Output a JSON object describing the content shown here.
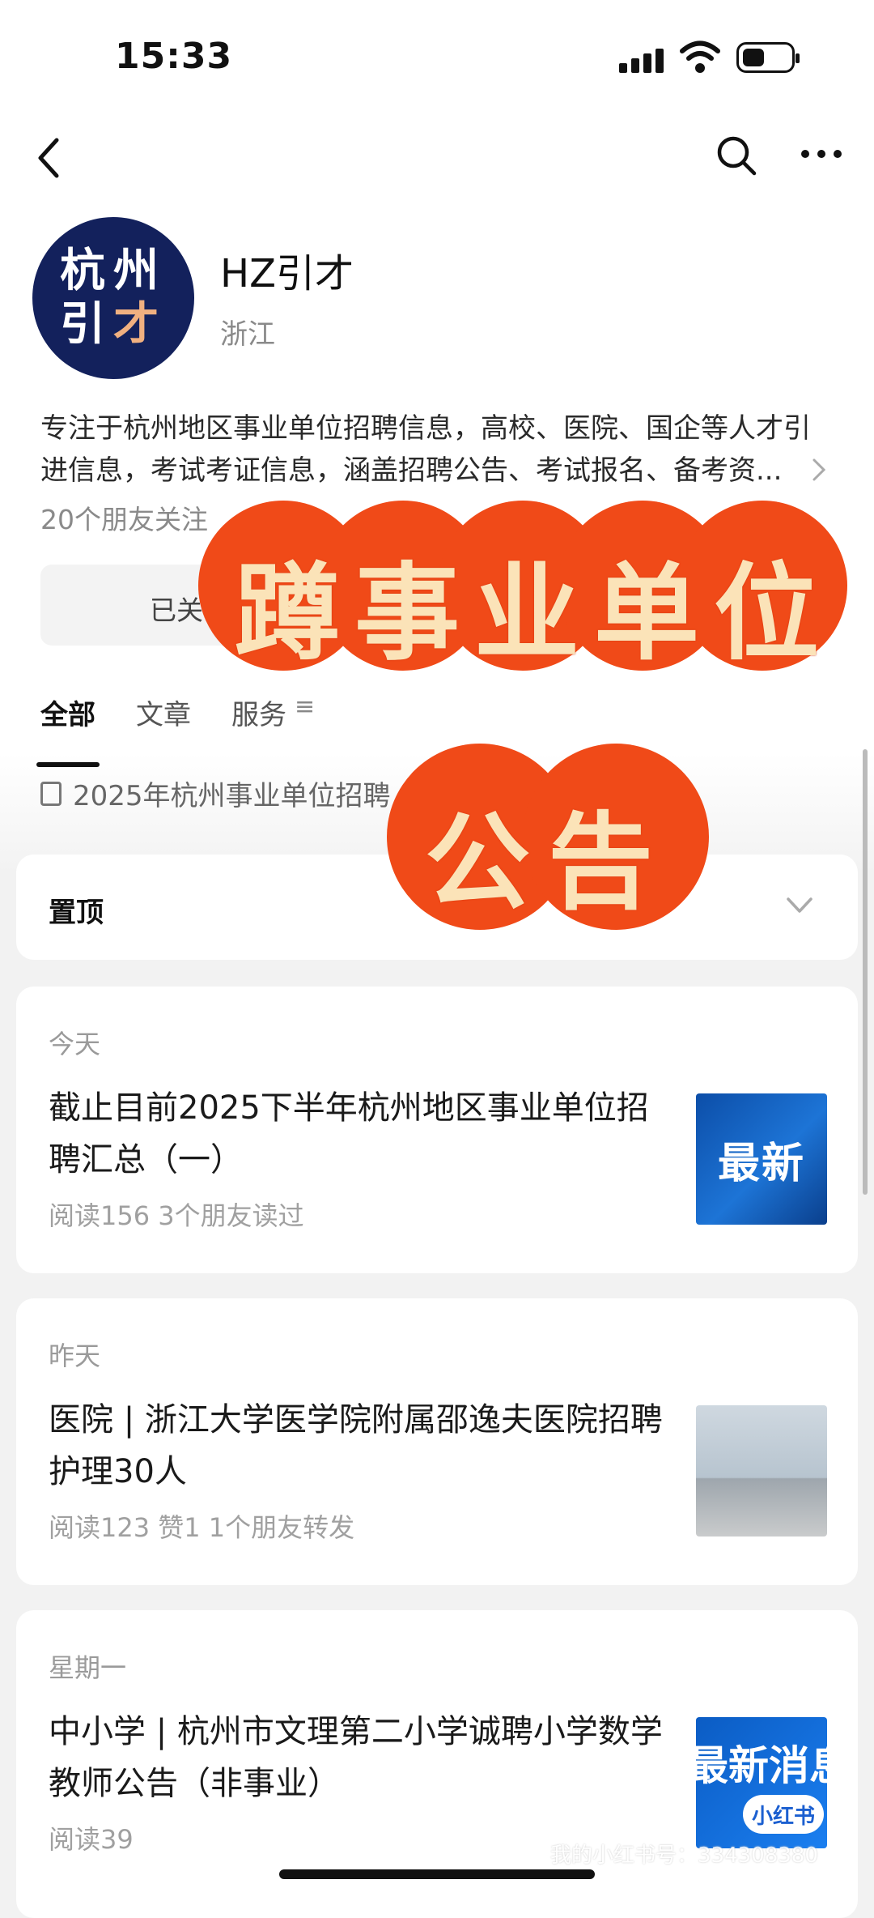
{
  "status_bar": {
    "time": "15:33"
  },
  "account": {
    "logo_line1": "杭州",
    "logo_line2_a": "引",
    "logo_line2_b": "才",
    "name": "HZ引才",
    "region": "浙江",
    "desc_line1": "专注于杭州地区事业单位招聘信息，高校、医院、国企等人才引",
    "desc_line2": "进信息，考试考证信息，涵盖招聘公告、考试报名、备考资...",
    "friends_following": "20个朋友关注",
    "follow_button": "已关"
  },
  "tabs": [
    {
      "label": "全部",
      "active": true
    },
    {
      "label": "文章",
      "active": false
    },
    {
      "label": "服务",
      "active": false
    }
  ],
  "tab_menu_icon": "≡",
  "notice": "2025年杭州事业单位招聘",
  "pinned": {
    "label": "置顶"
  },
  "articles": [
    {
      "day": "今天",
      "title": "截止目前2025下半年杭州地区事业单位招聘汇总（一）",
      "meta": "阅读156  3个朋友读过",
      "thumb_text": "最新"
    },
    {
      "day": "昨天",
      "title": "医院 | 浙江大学医学院附属邵逸夫医院招聘护理30人",
      "meta": "阅读123  赞1  1个朋友转发"
    },
    {
      "day": "星期一",
      "title": "中小学 | 杭州市文理第二小学诚聘小学数学教师公告（非事业）",
      "meta": "阅读39",
      "thumb_text": "最新消息",
      "thumb_badge": "小红书"
    }
  ],
  "overlay": {
    "line1": "蹲事业单位",
    "line2": "公告"
  },
  "watermark": "我的小红书号：334308380"
}
